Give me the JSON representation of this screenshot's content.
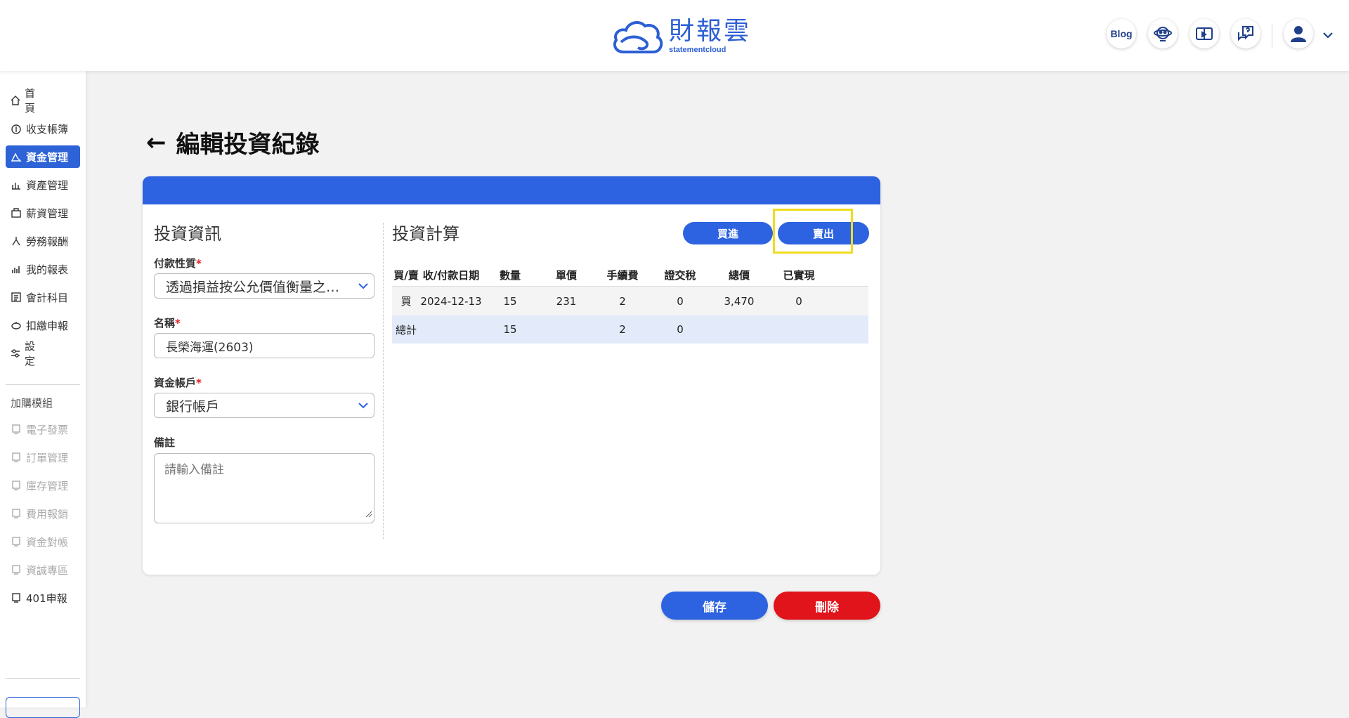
{
  "header": {
    "logo_cn": "財報雲",
    "logo_en": "statementcloud",
    "blog_label": "Blog",
    "icons": [
      "robot-icon",
      "video-book-icon",
      "help-chat-icon",
      "user-avatar-icon",
      "chevron-down-icon"
    ]
  },
  "sidebar": {
    "items": [
      {
        "label": "首頁",
        "icon": "home-icon"
      },
      {
        "label": "收支帳簿",
        "icon": "money-icon"
      },
      {
        "label": "資金管理",
        "icon": "fund-icon"
      },
      {
        "label": "資產管理",
        "icon": "asset-icon"
      },
      {
        "label": "薪資管理",
        "icon": "salary-icon"
      },
      {
        "label": "勞務報酬",
        "icon": "labor-icon"
      },
      {
        "label": "我的報表",
        "icon": "chart-icon"
      },
      {
        "label": "會計科目",
        "icon": "account-icon"
      },
      {
        "label": "扣繳申報",
        "icon": "tax-icon"
      },
      {
        "label": "設定",
        "icon": "settings-icon"
      }
    ],
    "module_title": "加購模組",
    "modules": [
      {
        "label": "電子發票"
      },
      {
        "label": "訂單管理"
      },
      {
        "label": "庫存管理"
      },
      {
        "label": "費用報銷"
      },
      {
        "label": "資金對帳"
      },
      {
        "label": "資誠專區"
      },
      {
        "label": "401申報"
      }
    ]
  },
  "page": {
    "back_arrow": "←",
    "title": "編輯投資紀錄"
  },
  "info": {
    "title": "投資資訊",
    "payment_label": "付款性質",
    "payment_value": "透過損益按公允價值衡量之金融資產",
    "name_label": "名稱",
    "name_value": "長榮海運(2603)",
    "account_label": "資金帳戶",
    "account_value": "銀行帳戶",
    "note_label": "備註",
    "note_placeholder": "請輸入備註",
    "required_mark": "*"
  },
  "calc": {
    "title": "投資計算",
    "buy_label": "買進",
    "sell_label": "賣出",
    "columns": [
      "買/賣",
      "收/付款日期",
      "數量",
      "單價",
      "手續費",
      "證交稅",
      "總價",
      "已實現"
    ],
    "rows": [
      [
        "買",
        "2024-12-13",
        "15",
        "231",
        "2",
        "0",
        "3,470",
        "0"
      ]
    ],
    "total": [
      "總計",
      "",
      "15",
      "",
      "2",
      "0",
      "",
      ""
    ]
  },
  "actions": {
    "save_label": "儲存",
    "delete_label": "刪除"
  },
  "colors": {
    "primary": "#2d63e0",
    "danger": "#e0141a",
    "highlight": "#f1dc1e"
  }
}
